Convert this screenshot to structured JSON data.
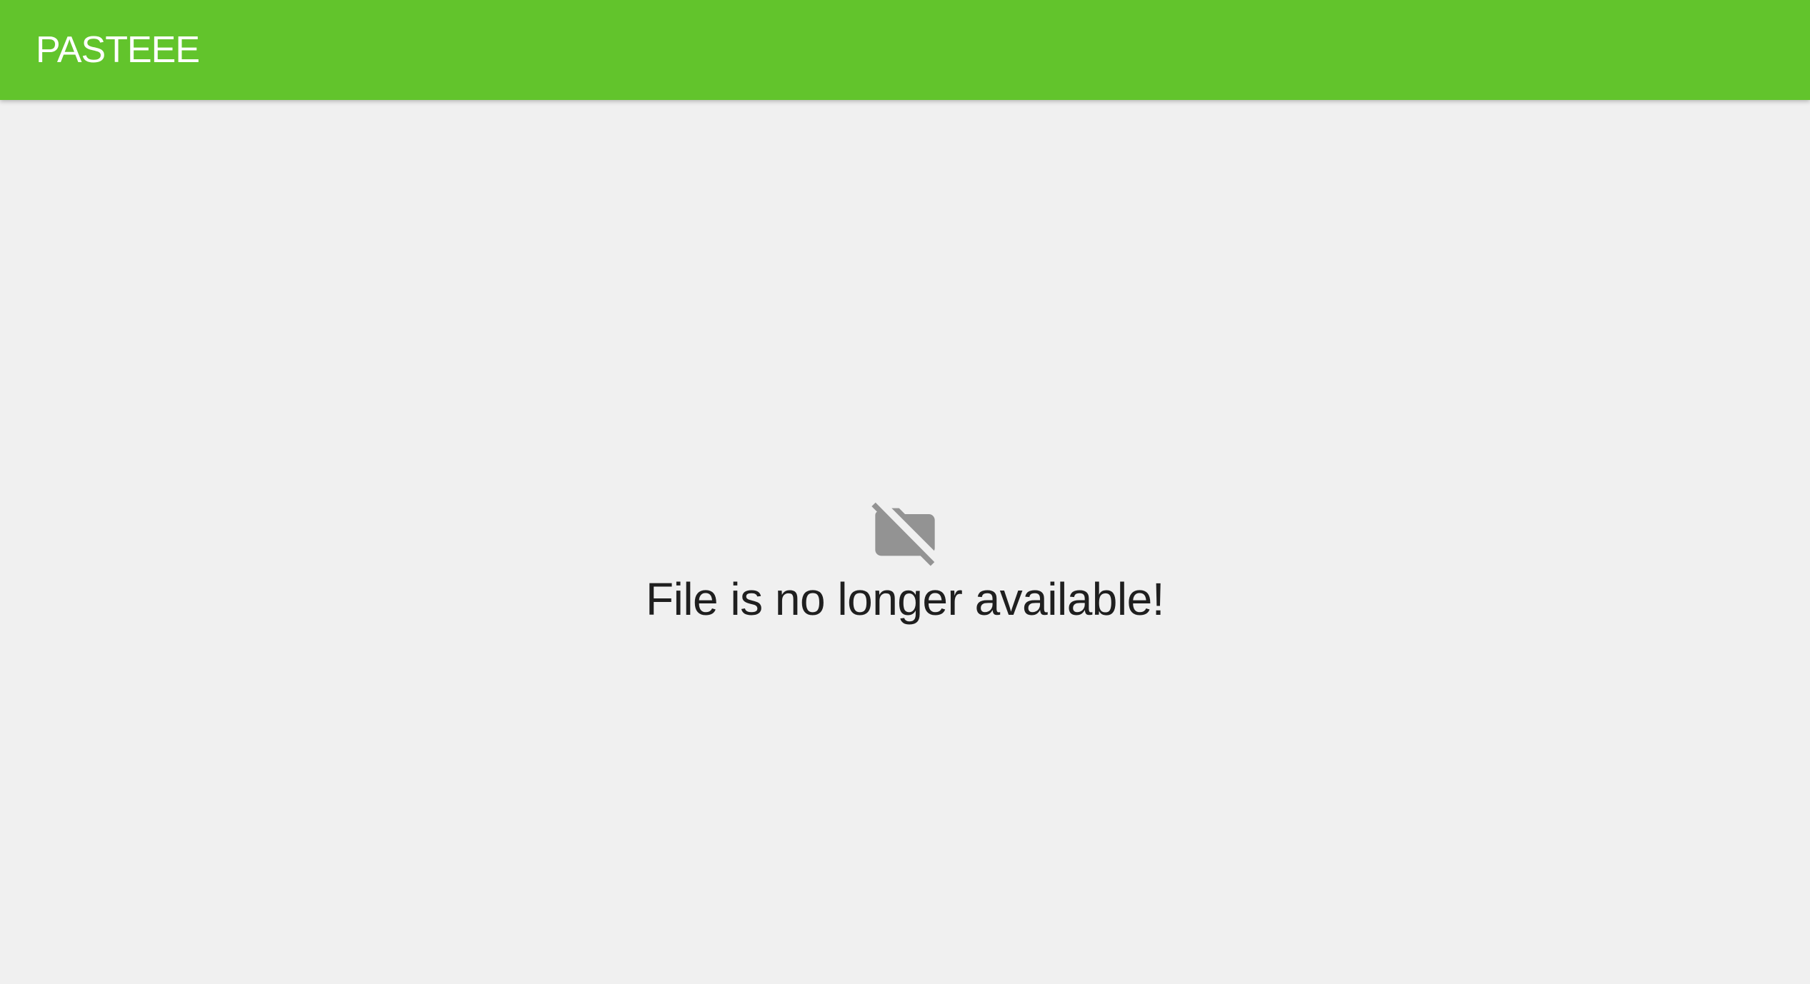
{
  "header": {
    "brand": "PASTEEE",
    "background_color": "#62c42c"
  },
  "main": {
    "icon": "folder-off-icon",
    "icon_color": "#939393",
    "message": "File is no longer available!"
  }
}
